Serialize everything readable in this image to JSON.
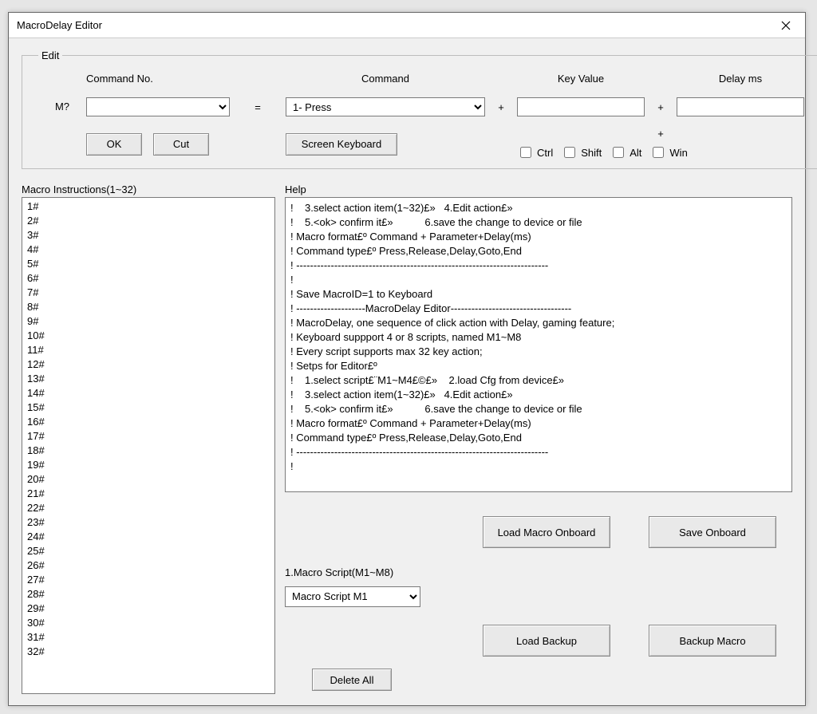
{
  "window": {
    "title": "MacroDelay Editor"
  },
  "edit": {
    "legend": "Edit",
    "labels": {
      "command_no": "Command No.",
      "m_prefix": "M?",
      "equals": "=",
      "command": "Command",
      "plus": "+",
      "key_value": "Key Value",
      "delay_ms": "Delay ms",
      "plus_single": "+"
    },
    "command_no_value": "",
    "command_value": "1- Press",
    "key_value": "",
    "delay_value": "",
    "buttons": {
      "ok": "OK",
      "cut": "Cut",
      "screen_keyboard": "Screen Keyboard"
    },
    "checks": {
      "ctrl": "Ctrl",
      "shift": "Shift",
      "alt": "Alt",
      "win": "Win"
    }
  },
  "macro_list": {
    "label": "Macro Instructions(1~32)",
    "items": [
      "1#",
      "2#",
      "3#",
      "4#",
      "5#",
      "6#",
      "7#",
      "8#",
      "9#",
      "10#",
      "11#",
      "12#",
      "13#",
      "14#",
      "15#",
      "16#",
      "17#",
      "18#",
      "19#",
      "20#",
      "21#",
      "22#",
      "23#",
      "24#",
      "25#",
      "26#",
      "27#",
      "28#",
      "29#",
      "30#",
      "31#",
      "32#"
    ]
  },
  "help": {
    "label": "Help",
    "lines": [
      "!    3.select action item(1~32)£»   4.Edit action£»",
      "!    5.<ok> confirm it£»           6.save the change to device or file",
      "! Macro format£º Command + Parameter+Delay(ms)",
      "! Command type£º Press,Release,Delay,Goto,End",
      "! -------------------------------------------------------------------------",
      "!",
      "! Save MacroID=1 to Keyboard",
      "! --------------------MacroDelay Editor-----------------------------------",
      "! MacroDelay, one sequence of click action with Delay, gaming feature;",
      "! Keyboard suppport 4 or 8 scripts, named M1~M8",
      "! Every script supports max 32 key action;",
      "! Setps for Editor£º",
      "!    1.select script£¨M1~M4£©£»    2.load Cfg from device£»",
      "!    3.select action item(1~32)£»   4.Edit action£»",
      "!    5.<ok> confirm it£»           6.save the change to device or file",
      "! Macro format£º Command + Parameter+Delay(ms)",
      "! Command type£º Press,Release,Delay,Goto,End",
      "! -------------------------------------------------------------------------",
      "!"
    ]
  },
  "macro_script": {
    "label": "1.Macro Script(M1~M8)",
    "value": "Macro Script M1"
  },
  "buttons": {
    "load_macro_onboard": "Load Macro Onboard",
    "save_onboard": "Save Onboard",
    "load_backup": "Load Backup",
    "backup_macro": "Backup Macro",
    "delete_all": "Delete All"
  }
}
